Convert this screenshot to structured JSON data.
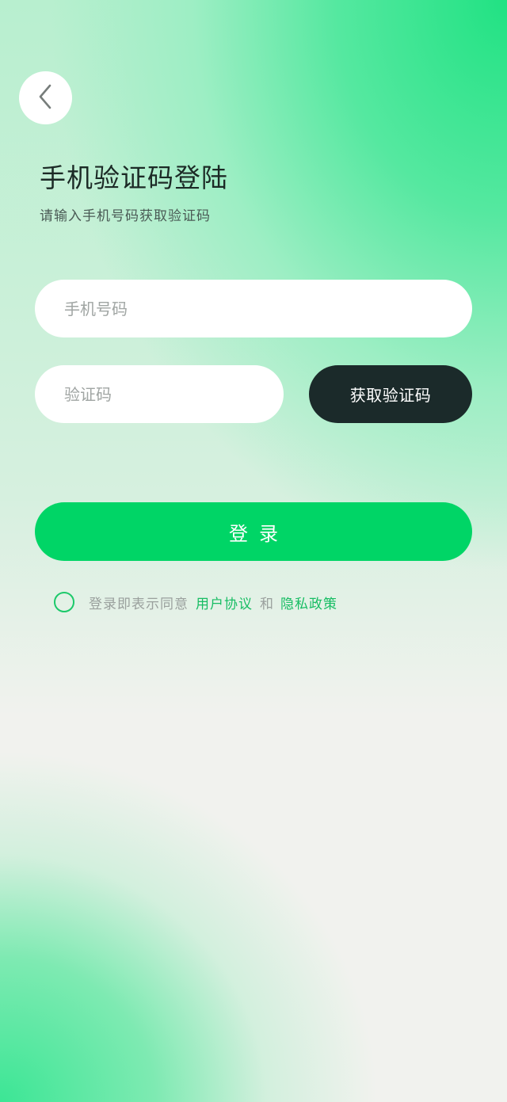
{
  "header": {
    "back_icon": "chevron-left-icon"
  },
  "title": "手机验证码登陆",
  "subtitle": "请输入手机号码获取验证码",
  "form": {
    "phone_placeholder": "手机号码",
    "phone_value": "",
    "code_placeholder": "验证码",
    "code_value": "",
    "get_code_label": "获取验证码",
    "login_label": "登录"
  },
  "agreement": {
    "checked": false,
    "prefix": "登录即表示同意",
    "user_agreement": "用户协议",
    "and": "和",
    "privacy_policy": "隐私政策"
  },
  "colors": {
    "accent": "#00d566",
    "dark_button": "#1b2a2a",
    "link": "#17bd63"
  }
}
